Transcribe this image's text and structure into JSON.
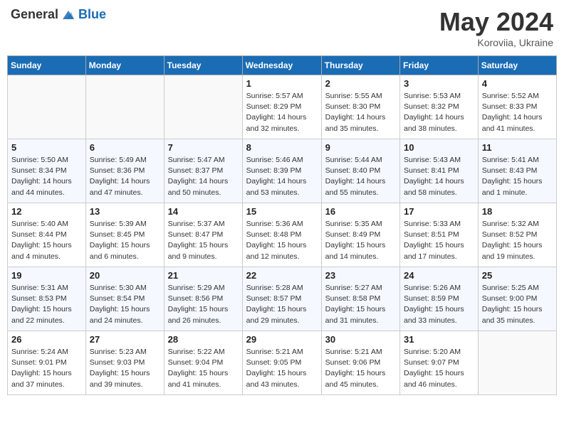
{
  "header": {
    "logo_general": "General",
    "logo_blue": "Blue",
    "title": "May 2024",
    "location": "Koroviia, Ukraine"
  },
  "weekdays": [
    "Sunday",
    "Monday",
    "Tuesday",
    "Wednesday",
    "Thursday",
    "Friday",
    "Saturday"
  ],
  "weeks": [
    [
      {
        "day": "",
        "info": ""
      },
      {
        "day": "",
        "info": ""
      },
      {
        "day": "",
        "info": ""
      },
      {
        "day": "1",
        "info": "Sunrise: 5:57 AM\nSunset: 8:29 PM\nDaylight: 14 hours\nand 32 minutes."
      },
      {
        "day": "2",
        "info": "Sunrise: 5:55 AM\nSunset: 8:30 PM\nDaylight: 14 hours\nand 35 minutes."
      },
      {
        "day": "3",
        "info": "Sunrise: 5:53 AM\nSunset: 8:32 PM\nDaylight: 14 hours\nand 38 minutes."
      },
      {
        "day": "4",
        "info": "Sunrise: 5:52 AM\nSunset: 8:33 PM\nDaylight: 14 hours\nand 41 minutes."
      }
    ],
    [
      {
        "day": "5",
        "info": "Sunrise: 5:50 AM\nSunset: 8:34 PM\nDaylight: 14 hours\nand 44 minutes."
      },
      {
        "day": "6",
        "info": "Sunrise: 5:49 AM\nSunset: 8:36 PM\nDaylight: 14 hours\nand 47 minutes."
      },
      {
        "day": "7",
        "info": "Sunrise: 5:47 AM\nSunset: 8:37 PM\nDaylight: 14 hours\nand 50 minutes."
      },
      {
        "day": "8",
        "info": "Sunrise: 5:46 AM\nSunset: 8:39 PM\nDaylight: 14 hours\nand 53 minutes."
      },
      {
        "day": "9",
        "info": "Sunrise: 5:44 AM\nSunset: 8:40 PM\nDaylight: 14 hours\nand 55 minutes."
      },
      {
        "day": "10",
        "info": "Sunrise: 5:43 AM\nSunset: 8:41 PM\nDaylight: 14 hours\nand 58 minutes."
      },
      {
        "day": "11",
        "info": "Sunrise: 5:41 AM\nSunset: 8:43 PM\nDaylight: 15 hours\nand 1 minute."
      }
    ],
    [
      {
        "day": "12",
        "info": "Sunrise: 5:40 AM\nSunset: 8:44 PM\nDaylight: 15 hours\nand 4 minutes."
      },
      {
        "day": "13",
        "info": "Sunrise: 5:39 AM\nSunset: 8:45 PM\nDaylight: 15 hours\nand 6 minutes."
      },
      {
        "day": "14",
        "info": "Sunrise: 5:37 AM\nSunset: 8:47 PM\nDaylight: 15 hours\nand 9 minutes."
      },
      {
        "day": "15",
        "info": "Sunrise: 5:36 AM\nSunset: 8:48 PM\nDaylight: 15 hours\nand 12 minutes."
      },
      {
        "day": "16",
        "info": "Sunrise: 5:35 AM\nSunset: 8:49 PM\nDaylight: 15 hours\nand 14 minutes."
      },
      {
        "day": "17",
        "info": "Sunrise: 5:33 AM\nSunset: 8:51 PM\nDaylight: 15 hours\nand 17 minutes."
      },
      {
        "day": "18",
        "info": "Sunrise: 5:32 AM\nSunset: 8:52 PM\nDaylight: 15 hours\nand 19 minutes."
      }
    ],
    [
      {
        "day": "19",
        "info": "Sunrise: 5:31 AM\nSunset: 8:53 PM\nDaylight: 15 hours\nand 22 minutes."
      },
      {
        "day": "20",
        "info": "Sunrise: 5:30 AM\nSunset: 8:54 PM\nDaylight: 15 hours\nand 24 minutes."
      },
      {
        "day": "21",
        "info": "Sunrise: 5:29 AM\nSunset: 8:56 PM\nDaylight: 15 hours\nand 26 minutes."
      },
      {
        "day": "22",
        "info": "Sunrise: 5:28 AM\nSunset: 8:57 PM\nDaylight: 15 hours\nand 29 minutes."
      },
      {
        "day": "23",
        "info": "Sunrise: 5:27 AM\nSunset: 8:58 PM\nDaylight: 15 hours\nand 31 minutes."
      },
      {
        "day": "24",
        "info": "Sunrise: 5:26 AM\nSunset: 8:59 PM\nDaylight: 15 hours\nand 33 minutes."
      },
      {
        "day": "25",
        "info": "Sunrise: 5:25 AM\nSunset: 9:00 PM\nDaylight: 15 hours\nand 35 minutes."
      }
    ],
    [
      {
        "day": "26",
        "info": "Sunrise: 5:24 AM\nSunset: 9:01 PM\nDaylight: 15 hours\nand 37 minutes."
      },
      {
        "day": "27",
        "info": "Sunrise: 5:23 AM\nSunset: 9:03 PM\nDaylight: 15 hours\nand 39 minutes."
      },
      {
        "day": "28",
        "info": "Sunrise: 5:22 AM\nSunset: 9:04 PM\nDaylight: 15 hours\nand 41 minutes."
      },
      {
        "day": "29",
        "info": "Sunrise: 5:21 AM\nSunset: 9:05 PM\nDaylight: 15 hours\nand 43 minutes."
      },
      {
        "day": "30",
        "info": "Sunrise: 5:21 AM\nSunset: 9:06 PM\nDaylight: 15 hours\nand 45 minutes."
      },
      {
        "day": "31",
        "info": "Sunrise: 5:20 AM\nSunset: 9:07 PM\nDaylight: 15 hours\nand 46 minutes."
      },
      {
        "day": "",
        "info": ""
      }
    ]
  ]
}
